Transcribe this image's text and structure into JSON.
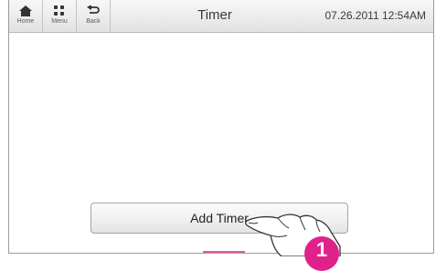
{
  "header": {
    "home_label": "Home",
    "menu_label": "Menu",
    "back_label": "Back",
    "title": "Timer",
    "datetime": "07.26.2011 12:54AM"
  },
  "main": {
    "add_timer_label": "Add Timer"
  },
  "callout": {
    "number": "1"
  },
  "colors": {
    "accent_pink": "#e85a9c",
    "callout_magenta": "#e0218a"
  },
  "icons": [
    "home-icon",
    "menu-grid-icon",
    "back-arrow-icon",
    "pointing-hand-icon"
  ]
}
